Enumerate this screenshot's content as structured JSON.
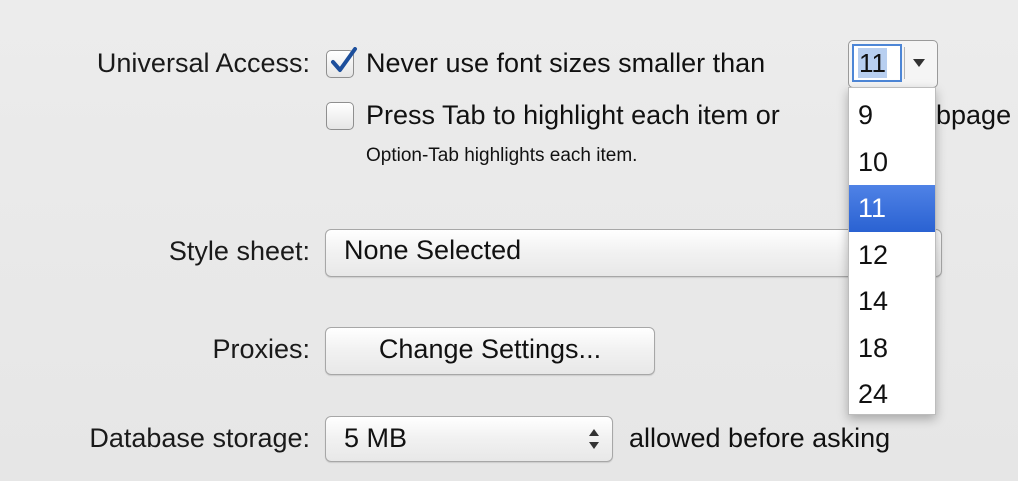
{
  "universal_access": {
    "label": "Universal Access:",
    "min_font_checkbox": {
      "checked": true,
      "label": "Never use font sizes smaller than"
    },
    "font_size_value": "11",
    "font_size_options": [
      "9",
      "10",
      "11",
      "12",
      "14",
      "18",
      "24"
    ],
    "font_size_selected": "11",
    "tab_checkbox": {
      "checked": false,
      "label": "Press Tab to highlight each item on a webpage"
    },
    "tab_label_visible_left": "Press Tab to highlight each item or",
    "tab_label_visible_right": "bpage",
    "tab_hint": "Option-Tab highlights each item."
  },
  "style_sheet": {
    "label": "Style sheet:",
    "value": "None Selected"
  },
  "proxies": {
    "label": "Proxies:",
    "button_label": "Change Settings..."
  },
  "database_storage": {
    "label": "Database storage:",
    "value": "5 MB",
    "suffix": "allowed before asking"
  },
  "colors": {
    "background": "#e9e9e9",
    "selection": "#2f66d8",
    "checkmark": "#1d4f9c",
    "focus_ring": "#4d86d6"
  }
}
